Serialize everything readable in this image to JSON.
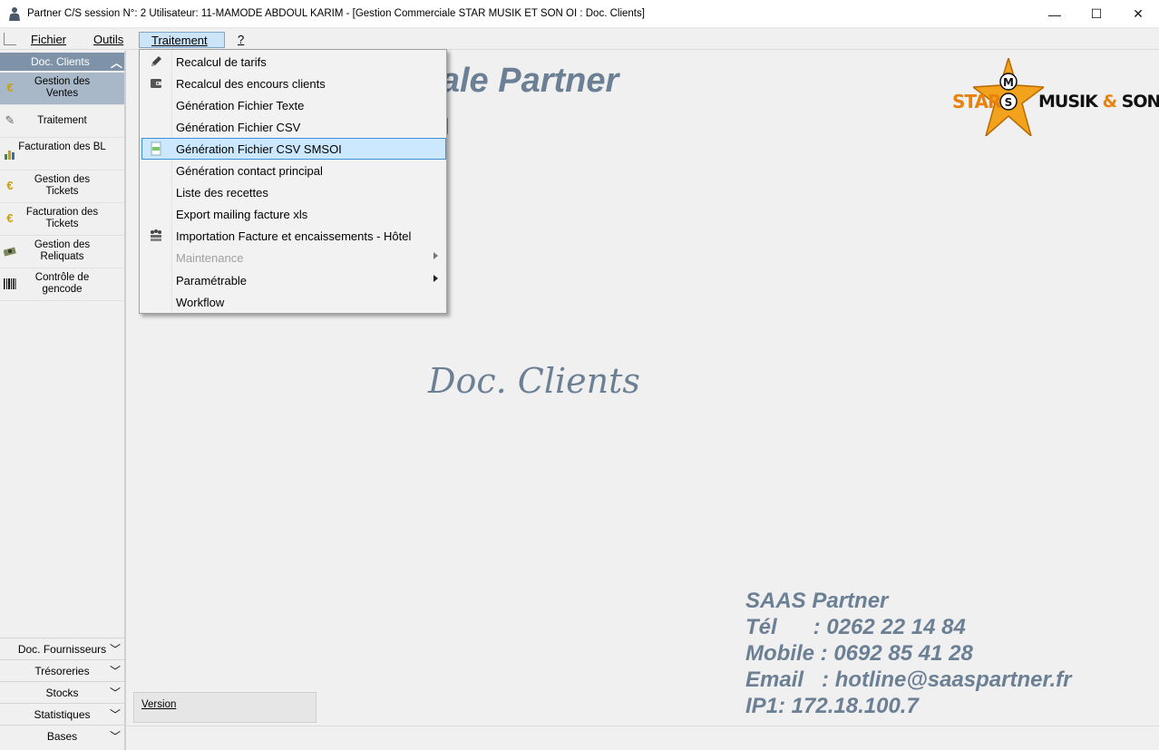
{
  "window": {
    "title": "Partner C/S session N°: 2 Utilisateur: 11-MAMODE ABDOUL KARIM - [Gestion Commerciale STAR MUSIK ET SON OI : Doc. Clients]",
    "minimize": "—",
    "maximize": "☐",
    "close": "✕"
  },
  "menubar": {
    "items": [
      "Fichier",
      "Outils",
      "Traitement",
      "?"
    ],
    "active": "Traitement"
  },
  "traitement_menu": {
    "items": [
      {
        "label": "Recalcul de tarifs",
        "icon": "pencil-icon"
      },
      {
        "label": "Recalcul des encours clients",
        "icon": "wallet-icon"
      },
      {
        "label": "Génération Fichier Texte",
        "icon": ""
      },
      {
        "label": "Génération Fichier CSV",
        "icon": ""
      },
      {
        "label": "Génération Fichier CSV SMSOI",
        "icon": "csv-file-icon",
        "highlighted": true
      },
      {
        "label": "Génération contact principal",
        "icon": ""
      },
      {
        "label": "Liste des recettes",
        "icon": ""
      },
      {
        "label": "Export mailing facture xls",
        "icon": ""
      },
      {
        "label": "Importation Facture et encaissements - Hôtel",
        "icon": "hotel-icon"
      },
      {
        "label": "Maintenance",
        "icon": "",
        "disabled": true,
        "submenu": true
      },
      {
        "label": "Paramétrable",
        "icon": "",
        "submenu": true
      },
      {
        "label": "Workflow",
        "icon": ""
      }
    ]
  },
  "sidebar": {
    "header": "Doc. Clients",
    "items": [
      {
        "label": "Gestion des Ventes",
        "icon": "euro-icon",
        "selected": true
      },
      {
        "label": "Traitement",
        "icon": "tools-icon"
      },
      {
        "label": "Facturation des BL",
        "icon": "chart-icon"
      },
      {
        "label": "Gestion des Tickets",
        "icon": "euro-icon"
      },
      {
        "label": "Facturation des Tickets",
        "icon": "euro-icon"
      },
      {
        "label": "Gestion des Reliquats",
        "icon": "money-icon"
      },
      {
        "label": "Contrôle de gencode",
        "icon": "barcode-icon"
      }
    ],
    "sections": [
      "Doc. Fournisseurs",
      "Trésoreries",
      "Stocks",
      "Statistiques",
      "Bases"
    ]
  },
  "main": {
    "title_partial": "ciale Partner",
    "subtitle_partial": "I",
    "section_title": "Doc. Clients",
    "logo": {
      "left": "STAR",
      "badge_top": "M",
      "badge_bottom": "S",
      "right": "MUSIK",
      "amp": "&",
      "right2": "SON"
    },
    "contact": {
      "line1": "SAAS Partner",
      "line2": "Tél      : 0262 22 14 84",
      "line3": "Mobile : 0692 85 41 28",
      "line4": "Email   : hotline@saaspartner.fr",
      "line5": "IP1: 172.18.100.7"
    },
    "version_link": "Version"
  },
  "colors": {
    "accent": "#6b7f95",
    "sidebar_header": "#7f93a8",
    "logo_orange": "#e8820c",
    "highlight": "#cce8ff"
  }
}
